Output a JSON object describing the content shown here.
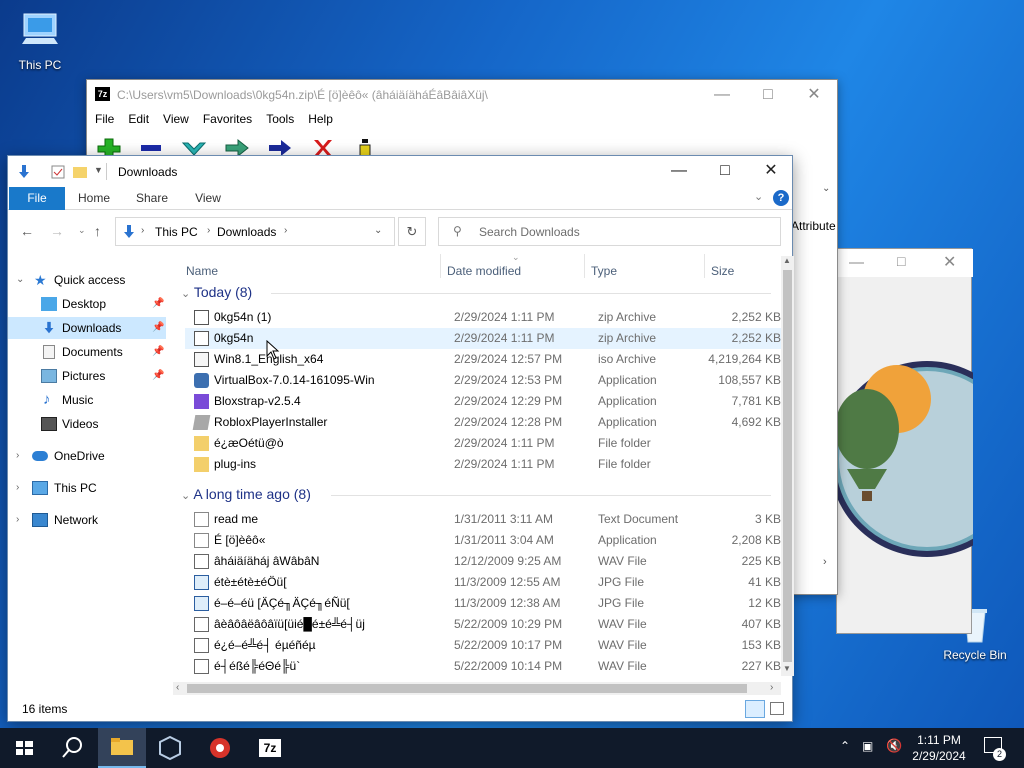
{
  "desktop": {
    "icons": [
      {
        "label": "This PC"
      },
      {
        "label": "Recycle Bin"
      }
    ]
  },
  "sevenzip": {
    "title": "C:\\Users\\vm5\\Downloads\\0kg54n.zip\\É [ö]èêô« (âháiäíäháÉâBâiâXüj\\",
    "menu": [
      "File",
      "Edit",
      "View",
      "Favorites",
      "Tools",
      "Help"
    ],
    "attributes_col": "Attribute"
  },
  "explorer": {
    "title": "Downloads",
    "tabs": [
      "File",
      "Home",
      "Share",
      "View"
    ],
    "breadcrumb": [
      "This PC",
      "Downloads"
    ],
    "search_placeholder": "Search Downloads",
    "columns": {
      "name": "Name",
      "date": "Date modified",
      "type": "Type",
      "size": "Size"
    },
    "nav": {
      "quick_access": "Quick access",
      "items": [
        "Desktop",
        "Downloads",
        "Documents",
        "Pictures",
        "Music",
        "Videos"
      ],
      "onedrive": "OneDrive",
      "thispc": "This PC",
      "network": "Network"
    },
    "groups": [
      {
        "label": "Today (8)",
        "rows": [
          {
            "name": "0kg54n (1)",
            "date": "2/29/2024 1:11 PM",
            "type": "zip Archive",
            "size": "2,252 KB",
            "icon": "zip-icon"
          },
          {
            "name": "0kg54n",
            "date": "2/29/2024 1:11 PM",
            "type": "zip Archive",
            "size": "2,252 KB",
            "icon": "zip-icon"
          },
          {
            "name": "Win8.1_English_x64",
            "date": "2/29/2024 12:57 PM",
            "type": "iso Archive",
            "size": "4,219,264 KB",
            "icon": "iso-icon"
          },
          {
            "name": "VirtualBox-7.0.14-161095-Win",
            "date": "2/29/2024 12:53 PM",
            "type": "Application",
            "size": "108,557 KB",
            "icon": "virtualbox-icon"
          },
          {
            "name": "Bloxstrap-v2.5.4",
            "date": "2/29/2024 12:29 PM",
            "type": "Application",
            "size": "7,781 KB",
            "icon": "bloxstrap-icon"
          },
          {
            "name": "RobloxPlayerInstaller",
            "date": "2/29/2024 12:28 PM",
            "type": "Application",
            "size": "4,692 KB",
            "icon": "roblox-icon"
          },
          {
            "name": "é¿æOétü@ò",
            "date": "2/29/2024 1:11 PM",
            "type": "File folder",
            "size": "",
            "icon": "folder-icon"
          },
          {
            "name": "plug-ins",
            "date": "2/29/2024 1:11 PM",
            "type": "File folder",
            "size": "",
            "icon": "folder-icon"
          }
        ]
      },
      {
        "label": "A long time ago (8)",
        "rows": [
          {
            "name": "read me",
            "date": "1/31/2011 3:11 AM",
            "type": "Text Document",
            "size": "3 KB",
            "icon": "text-file-icon"
          },
          {
            "name": "É [ö]èêô«",
            "date": "1/31/2011 3:04 AM",
            "type": "Application",
            "size": "2,208 KB",
            "icon": "app-file-icon"
          },
          {
            "name": "âháiäíäháj âWâbâN",
            "date": "12/12/2009 9:25 AM",
            "type": "WAV File",
            "size": "225 KB",
            "icon": "wav-icon"
          },
          {
            "name": "étè±étè±éÖü[",
            "date": "11/3/2009 12:55 AM",
            "type": "JPG File",
            "size": "41 KB",
            "icon": "jpg-icon"
          },
          {
            "name": "é–é–éü [ÄÇé╖ÄÇé╖éÑü[",
            "date": "11/3/2009 12:38 AM",
            "type": "JPG File",
            "size": "12 KB",
            "icon": "jpg-icon"
          },
          {
            "name": "âèâôâëâôâïü[üié█é±é╩é┤üj",
            "date": "5/22/2009 10:29 PM",
            "type": "WAV File",
            "size": "407 KB",
            "icon": "wav-icon"
          },
          {
            "name": "é¿é–é╩é┤ éµéñéµ",
            "date": "5/22/2009 10:17 PM",
            "type": "WAV File",
            "size": "153 KB",
            "icon": "wav-icon"
          },
          {
            "name": "é┤éßé╠éΘé╠ü`",
            "date": "5/22/2009 10:14 PM",
            "type": "WAV File",
            "size": "227 KB",
            "icon": "wav-icon"
          }
        ]
      }
    ],
    "status": "16 items"
  },
  "taskbar": {
    "time": "1:11 PM",
    "date": "2/29/2024",
    "notifications": "2"
  }
}
